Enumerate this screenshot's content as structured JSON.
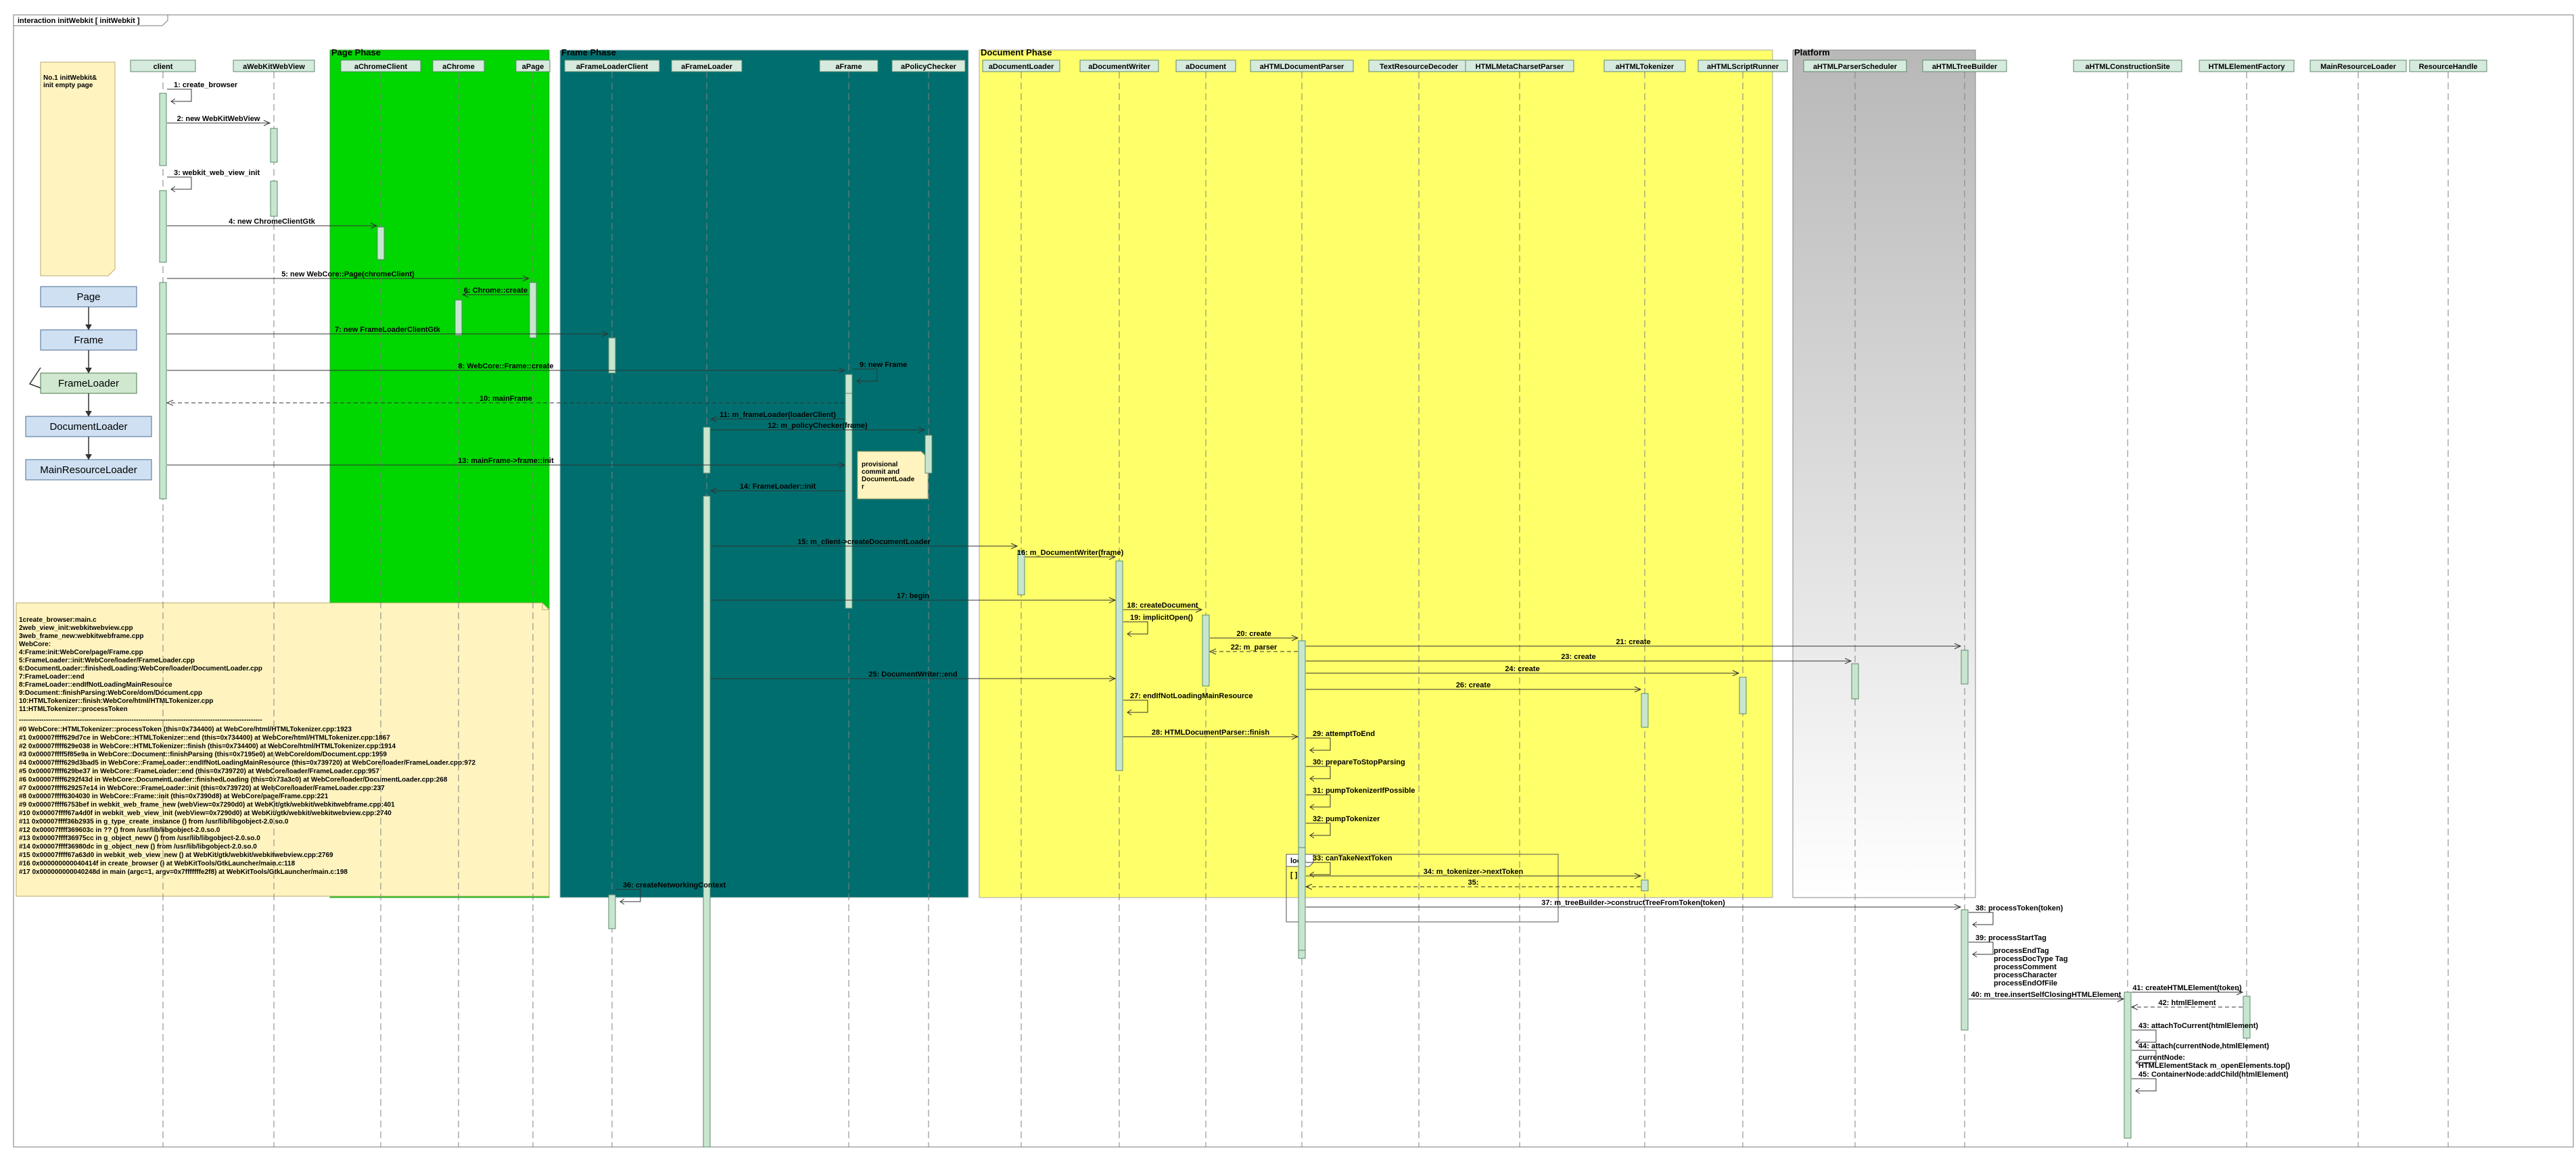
{
  "frame": {
    "label": "interaction  initWebkit [  initWebkit ]"
  },
  "phases": {
    "page": "Page Phase",
    "frame": "Frame Phase",
    "document": "Document Phase",
    "platform": "Platform"
  },
  "lifelines": [
    {
      "id": "client",
      "label": "client"
    },
    {
      "id": "wkview",
      "label": "aWebKitWebView"
    },
    {
      "id": "chromeclient",
      "label": "aChromeClient"
    },
    {
      "id": "chrome",
      "label": "aChrome"
    },
    {
      "id": "page",
      "label": "aPage"
    },
    {
      "id": "flclient",
      "label": "aFrameLoaderClient"
    },
    {
      "id": "floader",
      "label": "aFrameLoader"
    },
    {
      "id": "frame",
      "label": "aFrame"
    },
    {
      "id": "policy",
      "label": "aPolicyChecker"
    },
    {
      "id": "docloader",
      "label": "aDocumentLoader"
    },
    {
      "id": "docwriter",
      "label": "aDocumentWriter"
    },
    {
      "id": "document",
      "label": "aDocument"
    },
    {
      "id": "htmlparser",
      "label": "aHTMLDocumentParser"
    },
    {
      "id": "textdecoder",
      "label": "TextResourceDecoder"
    },
    {
      "id": "metacharset",
      "label": "HTMLMetaCharsetParser"
    },
    {
      "id": "tokenizer",
      "label": "aHTMLTokenizer"
    },
    {
      "id": "scriptrunner",
      "label": "aHTMLScriptRunner"
    },
    {
      "id": "scheduler",
      "label": "aHTMLParserScheduler"
    },
    {
      "id": "treebuilder",
      "label": "aHTMLTreeBuilder"
    },
    {
      "id": "construction",
      "label": "aHTMLConstructionSite"
    },
    {
      "id": "elemfactory",
      "label": "HTMLElementFactory"
    },
    {
      "id": "mainresloader",
      "label": "MainResourceLoader"
    },
    {
      "id": "reshandle",
      "label": "ResourceHandle"
    }
  ],
  "notes": {
    "top": [
      "No.1 initWebkit&",
      "init empty page"
    ],
    "provisional": [
      "provisional",
      "commit and",
      "DocumentLoade",
      "r"
    ]
  },
  "class_boxes": [
    "Page",
    "Frame",
    "FrameLoader",
    "DocumentLoader",
    "MainResourceLoader"
  ],
  "code_note": {
    "files": [
      "1create_browser:main.c",
      "2web_view_init:webkitwebview.cpp",
      "3web_frame_new:webkitwebframe.cpp",
      "WebCore:",
      "4:Frame:init:WebCore/page/Frame.cpp",
      "5:FrameLoader::init:WebCore/loader/FrameLoader.cpp",
      "6:DocumentLoader::finishedLoading:WebCore/loader/DocumentLoader.cpp",
      "7:FrameLoader::end",
      "8:FrameLoader::endIfNotLoadingMainResource",
      "9:Document::finishParsing:WebCore/dom/Document.cpp",
      "10:HTMLTokenizer::finish:WebCore/html/HTMLTokenizer.cpp",
      "11:HTMLTokenizer::processToken"
    ],
    "separator": "------------------------------------------------------------------------------------------------------------",
    "stack": [
      "#0  WebCore::HTMLTokenizer::processToken (this=0x734400) at WebCore/html/HTMLTokenizer.cpp:1923",
      "#1  0x00007ffff629d7ce in WebCore::HTMLTokenizer::end (this=0x734400) at WebCore/html/HTMLTokenizer.cpp:1867",
      "#2  0x00007ffff629e038 in WebCore::HTMLTokenizer::finish (this=0x734400) at WebCore/html/HTMLTokenizer.cpp:1914",
      "#3  0x00007ffff5f85e9a in WebCore::Document::finishParsing (this=0x7195e0) at WebCore/dom/Document.cpp:1959",
      "#4  0x00007ffff629d3bad5 in WebCore::FrameLoader::endIfNotLoadingMainResource (this=0x739720) at WebCore/loader/FrameLoader.cpp:972",
      "#5  0x00007ffff629be37 in WebCore::FrameLoader::end (this=0x739720) at WebCore/loader/FrameLoader.cpp:957",
      "#6  0x00007ffff6292f43d in WebCore::DocumentLoader::finishedLoading (this=0x73a3c0) at WebCore/loader/DocumentLoader.cpp:268",
      "#7  0x00007ffff629257e14 in WebCore::FrameLoader::init (this=0x739720) at WebCore/loader/FrameLoader.cpp:237",
      "#8  0x00007ffff6304030 in WebCore::Frame::init (this=0x7390d8) at WebCore/page/Frame.cpp:221",
      "#9  0x00007ffff6753bef in webkit_web_frame_new (webView=0x7290d0) at WebKit/gtk/webkit/webkitwebframe.cpp:401",
      "#10 0x00007ffff67a4d0f in webkit_web_view_init (webView=0x7290d0) at WebKit/gtk/webkit/webkitwebview.cpp:2740",
      "#11 0x00007ffff36b2935 in g_type_create_instance () from /usr/lib/libgobject-2.0.so.0",
      "#12 0x00007ffff369603c in ?? () from /usr/lib/libgobject-2.0.so.0",
      "#13 0x00007ffff36975cc in g_object_newv () from /usr/lib/libgobject-2.0.so.0",
      "#14 0x00007ffff36980dc in g_object_new () from /usr/lib/libgobject-2.0.so.0",
      "#15 0x00007ffff67a63d0 in webkit_web_view_new () at WebKit/gtk/webkit/webkitwebview.cpp:2769",
      "#16 0x000000000040414f in create_browser () at WebKitTools/GtkLauncher/main.c:118",
      "#17 0x000000000040248d in main (argc=1, argv=0x7fffffffe2f8) at WebKitTools/GtkLauncher/main.c:198"
    ]
  },
  "messages": [
    {
      "label": "1: create_browser"
    },
    {
      "label": "2: new WebKitWebView"
    },
    {
      "label": "3: webkit_web_view_init"
    },
    {
      "label": "4: new ChromeClientGtk"
    },
    {
      "label": "5: new WebCore::Page(chromeClient)"
    },
    {
      "label": "6: Chrome::create"
    },
    {
      "label": "7: new FrameLoaderClientGtk"
    },
    {
      "label": "8: WebCore::Frame::create"
    },
    {
      "label": "9: new Frame"
    },
    {
      "label": "10: mainFrame"
    },
    {
      "label": "11: m_frameLoader(loaderClient)"
    },
    {
      "label": "12: m_policyChecker(frame)"
    },
    {
      "label": "13: mainFrame->frame::init"
    },
    {
      "label": "14: FrameLoader::init"
    },
    {
      "label": "15: m_client->createDocumentLoader"
    },
    {
      "label": "16: m_DocumentWriter(frame)"
    },
    {
      "label": "17: begin"
    },
    {
      "label": "18: createDocument"
    },
    {
      "label": "19: implicitOpen()"
    },
    {
      "label": "20: create"
    },
    {
      "label": "21: create"
    },
    {
      "label": "22: m_parser"
    },
    {
      "label": "23: create"
    },
    {
      "label": "24: create"
    },
    {
      "label": "25: DocumentWriter::end"
    },
    {
      "label": "26: create"
    },
    {
      "label": "27: endIfNotLoadingMainResource"
    },
    {
      "label": "28: HTMLDocumentParser::finish"
    },
    {
      "label": "29: attemptToEnd"
    },
    {
      "label": "30: prepareToStopParsing"
    },
    {
      "label": "31: pumpTokenizerIfPossible"
    },
    {
      "label": "32: pumpTokenizer"
    },
    {
      "label": "33: canTakeNextToken"
    },
    {
      "label": "34: m_tokenizer->nextToken"
    },
    {
      "label": "35:"
    },
    {
      "label": "36: createNetworkingContext"
    },
    {
      "label": "37: m_treeBuilder->constructTreeFromToken(token)"
    },
    {
      "label": "38: processToken(token)"
    },
    {
      "label": "39: processStartTag"
    },
    {
      "label": "40: m_tree.insertSelfClosingHTMLElement"
    },
    {
      "label": "41: createHTMLElement(token)"
    },
    {
      "label": "42: htmlElement"
    },
    {
      "label": "43: attachToCurrent(htmlElement)"
    },
    {
      "label": "44: attach(currentNode,htmlElement)"
    },
    {
      "label": "45: ContainerNode:addChild(htmlElement)"
    }
  ],
  "extra_labels": {
    "process_list": [
      "processEndTag",
      "processDocType Tag",
      "processComment",
      "processCharacter",
      "processEndOfFile"
    ],
    "attach_detail": [
      "currentNode:",
      "HTMLElementStack m_openElements.top()"
    ],
    "loop": {
      "keyword": "loop",
      "guard": "[ ]"
    }
  }
}
